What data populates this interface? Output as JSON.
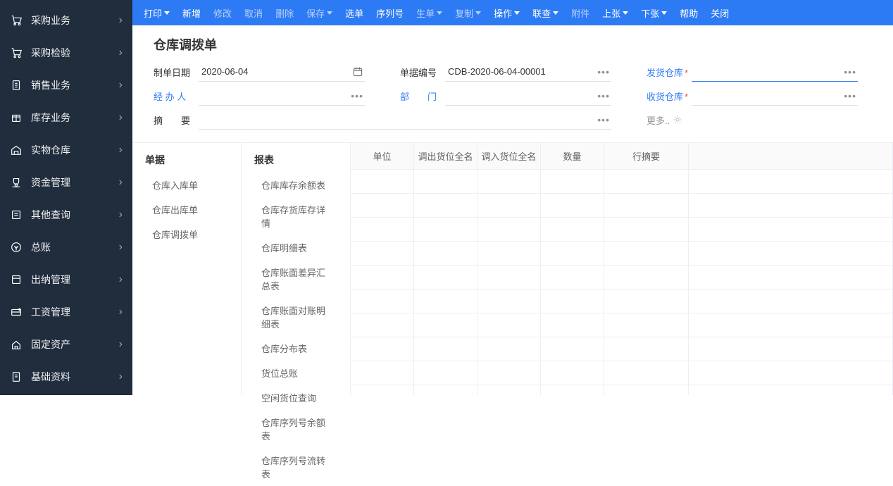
{
  "sidebar": [
    {
      "label": "采购业务",
      "icon": "cart"
    },
    {
      "label": "采购检验",
      "icon": "cart"
    },
    {
      "label": "销售业务",
      "icon": "doc"
    },
    {
      "label": "库存业务",
      "icon": "box"
    },
    {
      "label": "实物仓库",
      "icon": "warehouse"
    },
    {
      "label": "资金管理",
      "icon": "money"
    },
    {
      "label": "其他查询",
      "icon": "search"
    },
    {
      "label": "总账",
      "icon": "coin"
    },
    {
      "label": "出纳管理",
      "icon": "cash"
    },
    {
      "label": "工资管理",
      "icon": "pay"
    },
    {
      "label": "固定资产",
      "icon": "house"
    },
    {
      "label": "基础资料",
      "icon": "files"
    }
  ],
  "toolbar": [
    {
      "label": "打印",
      "caret": true,
      "dim": false
    },
    {
      "label": "新增",
      "caret": false,
      "dim": false
    },
    {
      "label": "修改",
      "caret": false,
      "dim": true
    },
    {
      "label": "取消",
      "caret": false,
      "dim": true
    },
    {
      "label": "删除",
      "caret": false,
      "dim": true
    },
    {
      "label": "保存",
      "caret": true,
      "dim": true
    },
    {
      "label": "选单",
      "caret": false,
      "dim": false
    },
    {
      "label": "序列号",
      "caret": false,
      "dim": false
    },
    {
      "label": "生单",
      "caret": true,
      "dim": true
    },
    {
      "label": "复制",
      "caret": true,
      "dim": true
    },
    {
      "label": "操作",
      "caret": true,
      "dim": false
    },
    {
      "label": "联查",
      "caret": true,
      "dim": false
    },
    {
      "label": "附件",
      "caret": false,
      "dim": true
    },
    {
      "label": "上张",
      "caret": true,
      "dim": false
    },
    {
      "label": "下张",
      "caret": true,
      "dim": false
    },
    {
      "label": "帮助",
      "caret": false,
      "dim": false
    },
    {
      "label": "关闭",
      "caret": false,
      "dim": false
    }
  ],
  "page_title": "仓库调拨单",
  "form": {
    "date_label": "制单日期",
    "date_value": "2020-06-04",
    "doc_no_label": "单据编号",
    "doc_no_value": "CDB-2020-06-04-00001",
    "ship_wh_label": "发货仓库",
    "handler_label": "经 办 人",
    "dept_label": "部　　门",
    "recv_wh_label": "收货仓库",
    "summary_label": "摘　　要",
    "more_label": "更多.."
  },
  "submenu": {
    "group1_title": "单据",
    "group1_items": [
      "仓库入库单",
      "仓库出库单",
      "仓库调拨单"
    ],
    "group2_title": "报表",
    "group2_items": [
      "仓库库存余额表",
      "仓库存货库存详情",
      "仓库明细表",
      "仓库账面差异汇总表",
      "仓库账面对账明细表",
      "仓库分布表",
      "货位总账",
      "空闲货位查询",
      "仓库序列号余额表",
      "仓库序列号流转表"
    ]
  },
  "grid": {
    "headers": {
      "unit": "单位",
      "out_loc": "调出货位全名",
      "in_loc": "调入货位全名",
      "qty": "数量",
      "note": "行摘要"
    },
    "row_count": 10
  }
}
